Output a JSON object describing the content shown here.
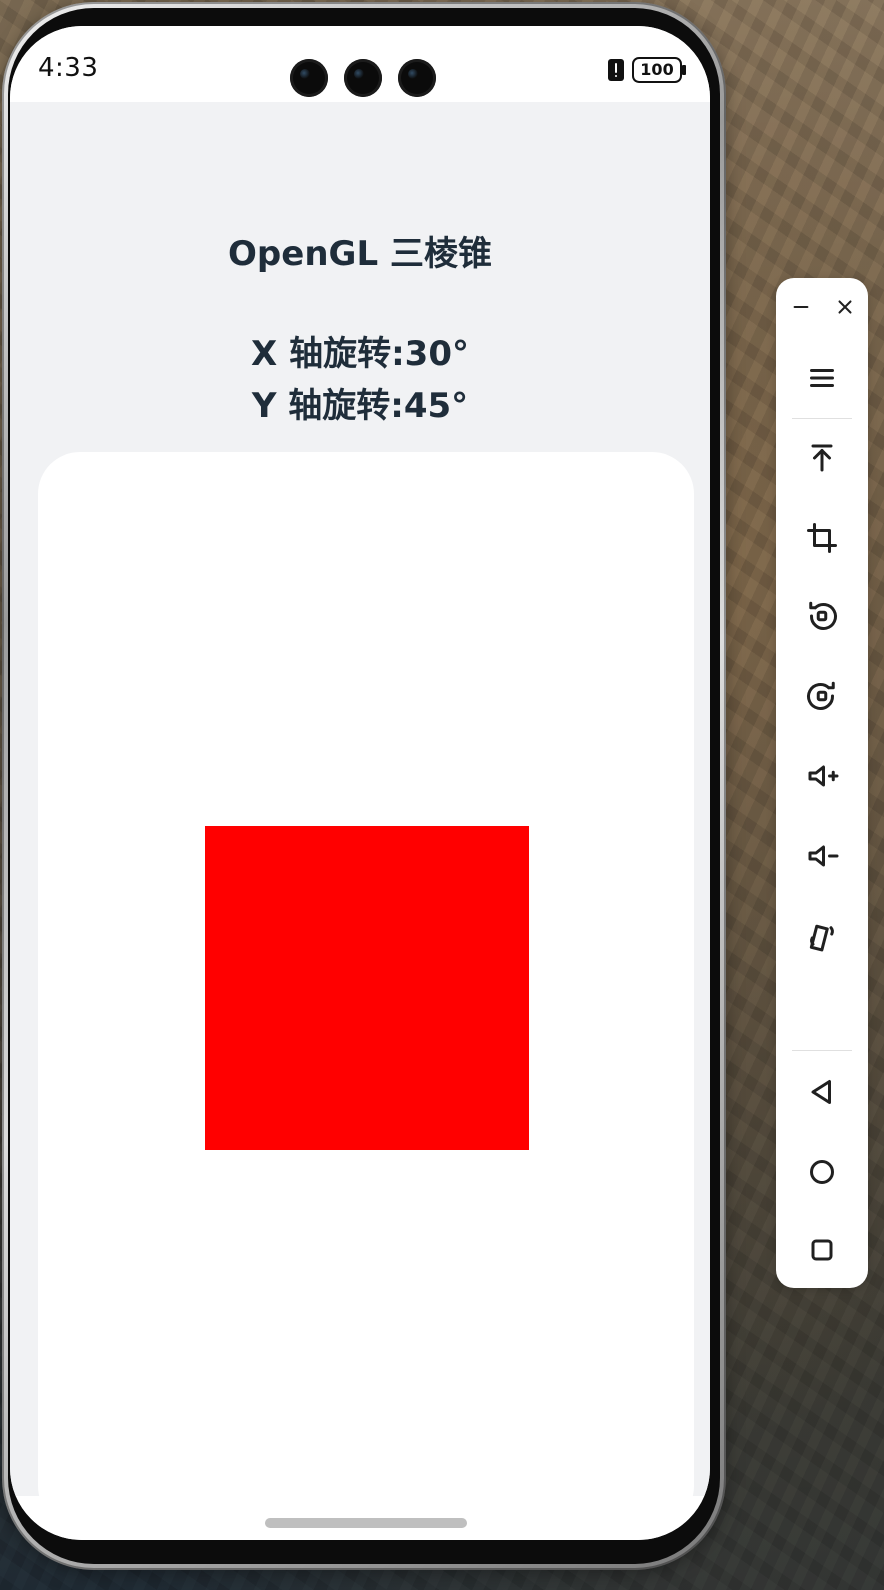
{
  "status_bar": {
    "time": "4:33",
    "battery_level": "100"
  },
  "app": {
    "title": "OpenGL 三棱锥",
    "x_rotation_label": "X 轴旋转:30°",
    "y_rotation_label": "Y 轴旋转:45°"
  },
  "gl_view": {
    "shape_color": "#FF0000"
  },
  "emulator_toolbar": {
    "minimize_icon": "minimize-icon",
    "close_icon": "close-icon",
    "menu_icon": "menu-icon",
    "upload_icon": "upload-icon",
    "crop_icon": "crop-icon",
    "rotate_left_icon": "rotate-left-icon",
    "rotate_right_icon": "rotate-right-icon",
    "volume_up_icon": "volume-up-icon",
    "volume_down_icon": "volume-down-icon",
    "shake_icon": "shake-icon",
    "back_icon": "back-icon",
    "home_icon": "home-icon",
    "overview_icon": "overview-icon"
  }
}
